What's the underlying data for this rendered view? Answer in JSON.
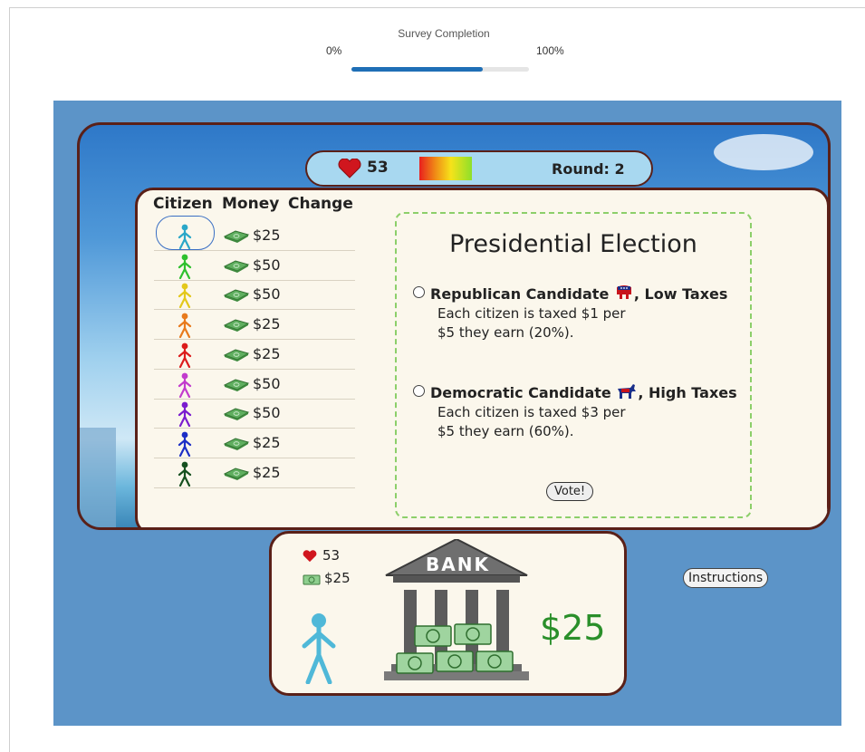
{
  "survey": {
    "label": "Survey Completion",
    "min_label": "0%",
    "max_label": "100%",
    "progress_percent": 74,
    "bar_color": "#1f6fb6"
  },
  "status": {
    "hearts": "53",
    "round_label": "Round: 2"
  },
  "table": {
    "headers": [
      "Citizen",
      "Money",
      "Change"
    ],
    "rows": [
      {
        "color": "#2aa7c8",
        "money": "$25",
        "selected": true
      },
      {
        "color": "#2ec02e",
        "money": "$50"
      },
      {
        "color": "#e3c81a",
        "money": "$50"
      },
      {
        "color": "#e87a1c",
        "money": "$25"
      },
      {
        "color": "#dc1c1c",
        "money": "$25"
      },
      {
        "color": "#c23ccd",
        "money": "$50"
      },
      {
        "color": "#7a1ccf",
        "money": "$50"
      },
      {
        "color": "#1c2ec6",
        "money": "$25"
      },
      {
        "color": "#15501f",
        "money": "$25"
      }
    ]
  },
  "ballot": {
    "title": "Presidential Election",
    "options": [
      {
        "name": "Republican Candidate",
        "suffix": ", Low Taxes",
        "line1": "Each citizen is taxed $1 per",
        "line2": "$5 they earn (20%).",
        "icon": "elephant-icon"
      },
      {
        "name": "Democratic Candidate",
        "suffix": ", High Taxes",
        "line1": "Each citizen is taxed $3 per",
        "line2": "$5 they earn (60%).",
        "icon": "donkey-icon"
      }
    ],
    "vote_label": "Vote!"
  },
  "bank": {
    "hearts": "53",
    "money": "$25",
    "sign": "BANK",
    "balance": "$25"
  },
  "instructions_label": "Instructions",
  "colors": {
    "frame_border": "#5a2018",
    "panel_bg": "#fbf7ec",
    "game_bg": "#5c94c8",
    "balance_green": "#2a8f2a",
    "heart_red": "#d0161e"
  }
}
